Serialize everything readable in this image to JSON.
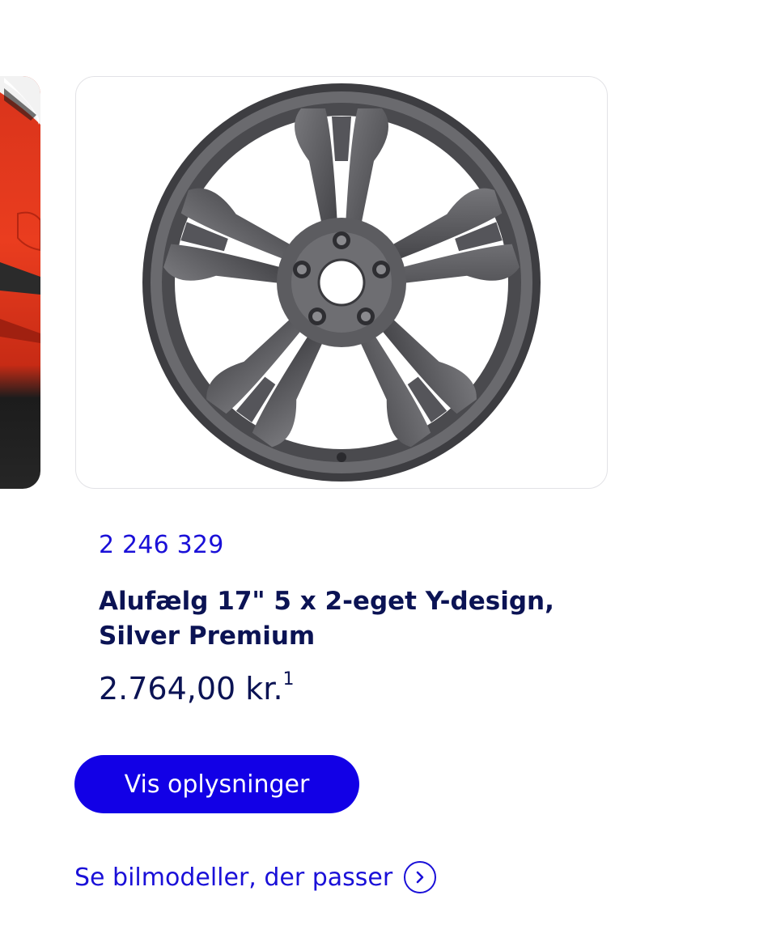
{
  "product": {
    "part_number": "2 246 329",
    "title": "Alufælg 17\" 5 x 2-eget Y-design, Silver Premium",
    "price": "2.764,00 kr.",
    "price_footnote": "1",
    "image_icon": "alloy-wheel-icon"
  },
  "actions": {
    "details_button": "Vis oplysninger",
    "compatible_models_link": "Se bilmodeller, der passer",
    "link_icon": "chevron-right-circle-icon"
  },
  "colors": {
    "accent": "#1200e6",
    "link": "#1a10d8",
    "text_dark": "#0b1354",
    "previous_card_car": "#e23a1e"
  }
}
